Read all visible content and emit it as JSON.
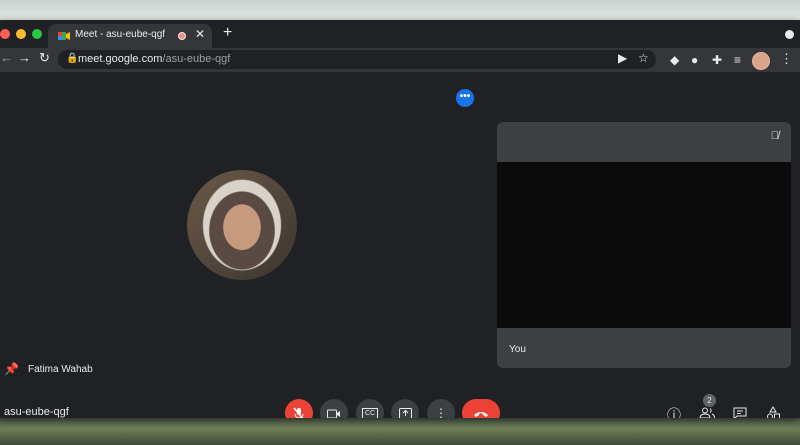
{
  "browser": {
    "tab": {
      "title": "Meet - asu-eube-qgf",
      "close": "✕"
    },
    "new_tab": "+",
    "url_host": "meet.google.com",
    "url_path": "/asu-eube-qgf"
  },
  "meeting": {
    "participant_name": "Fatima Wahab",
    "self_label": "You",
    "meeting_code": "asu-eube-qgf",
    "people_count": "2",
    "more_options": "•••"
  },
  "colors": {
    "accent": "#1a73e8",
    "danger": "#ea4335",
    "surface": "#3c4043",
    "background": "#202124"
  }
}
